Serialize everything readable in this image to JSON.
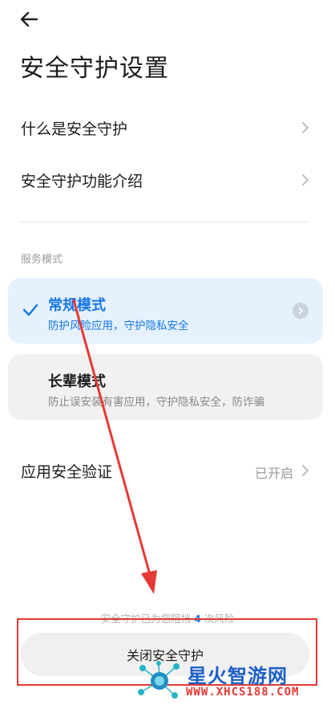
{
  "header": {
    "back_icon": "arrow-left-icon",
    "title": "安全守护设置"
  },
  "links": [
    {
      "label": "什么是安全守护",
      "icon": "chevron-right-icon"
    },
    {
      "label": "安全守护功能介绍",
      "icon": "chevron-right-icon"
    }
  ],
  "service_mode": {
    "section_title": "服务模式",
    "selected": "常规模式",
    "modes": [
      {
        "title": "常规模式",
        "desc": "防护风险应用，守护隐私安全"
      },
      {
        "title": "长辈模式",
        "desc": "防止误安装有害应用，守护隐私安全，防诈骗"
      }
    ]
  },
  "app_verify": {
    "label": "应用安全验证",
    "status": "已开启"
  },
  "blocked": {
    "prefix": "安全守护已为您阻挡",
    "count": "4",
    "suffix": "次风险"
  },
  "close_button": {
    "label": "关闭安全守护"
  },
  "watermark": {
    "title": "星火智游网",
    "url": "WWW.XHCS188.COM"
  },
  "colors": {
    "accent": "#1677e8",
    "highlight": "#e53935",
    "selected_card_bg": "#e6f1fe",
    "card_bg": "#f1f1f1"
  }
}
